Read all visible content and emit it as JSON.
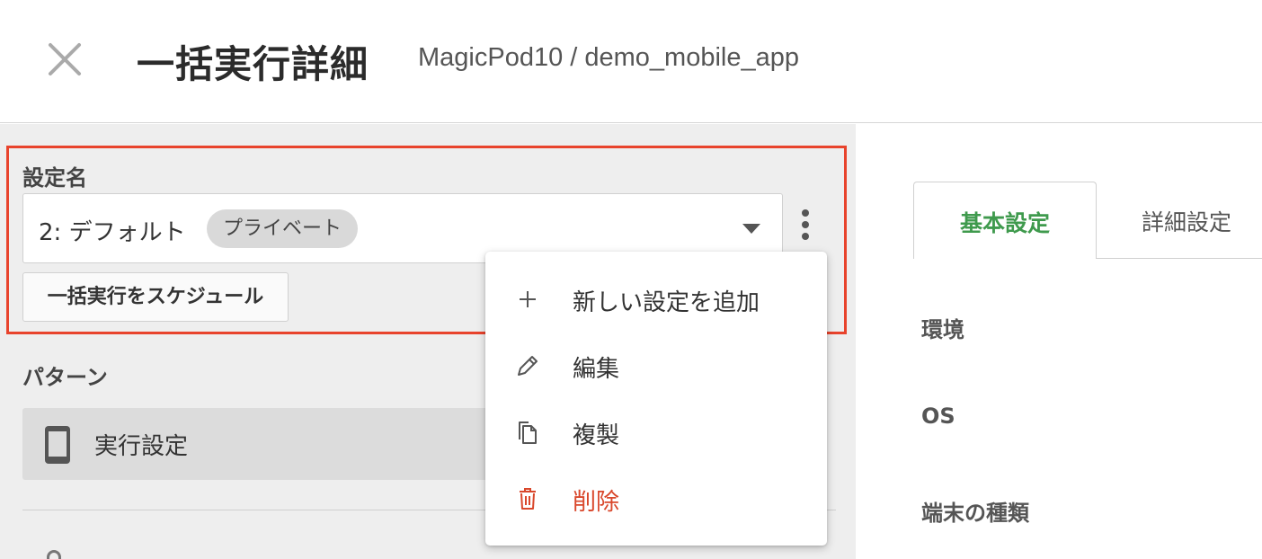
{
  "header": {
    "title": "一括実行詳細",
    "project_path": "MagicPod10 / demo_mobile_app"
  },
  "left": {
    "setting_label": "設定名",
    "select": {
      "value": "2: デフォルト",
      "badge": "プライベート"
    },
    "schedule_button": "一括実行をスケジュール",
    "pattern_label": "パターン",
    "pattern_item": "実行設定"
  },
  "menu": {
    "items": [
      {
        "label": "新しい設定を追加",
        "icon": "plus-icon"
      },
      {
        "label": "編集",
        "icon": "pencil-icon"
      },
      {
        "label": "複製",
        "icon": "copy-icon"
      },
      {
        "label": "削除",
        "icon": "trash-icon",
        "color": "#d9472b"
      }
    ]
  },
  "right": {
    "tabs": [
      {
        "label": "基本設定",
        "active": true
      },
      {
        "label": "詳細設定",
        "active": false
      }
    ],
    "fields": [
      "環境",
      "OS",
      "端末の種類"
    ]
  },
  "colors": {
    "highlight": "#e8432c",
    "active_tab": "#3f9a4d",
    "danger": "#d9472b"
  }
}
